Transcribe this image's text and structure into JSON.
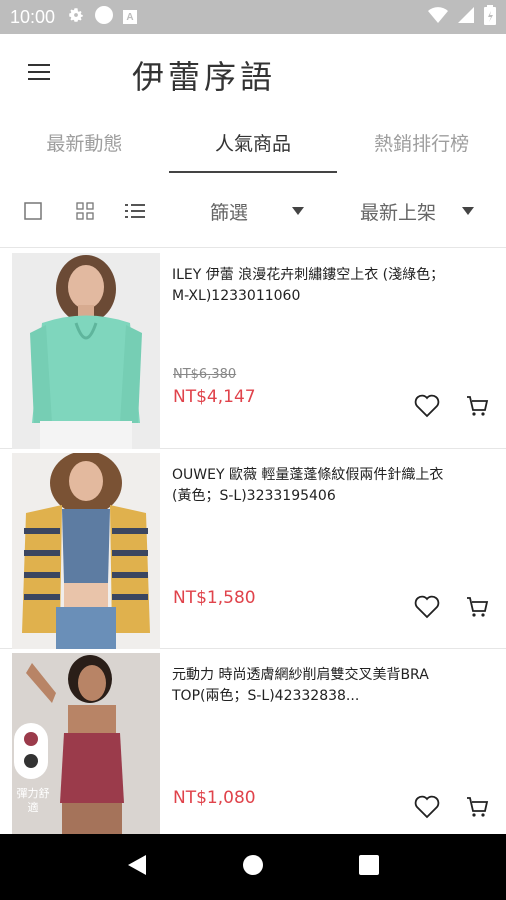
{
  "status_bar": {
    "time": "10:00",
    "mini_letter": "A"
  },
  "app": {
    "title": "伊蕾序語"
  },
  "tabs": [
    {
      "label": "最新動態",
      "active": false
    },
    {
      "label": "人氣商品",
      "active": true
    },
    {
      "label": "熱銷排行榜",
      "active": false
    }
  ],
  "toolbar": {
    "filter_label": "篩選",
    "sort_label": "最新上架"
  },
  "products": [
    {
      "name": "ILEY 伊蕾 浪漫花卉刺繡鏤空上衣 (淺綠色；M-XL)1233011060",
      "old_price": "NT$6,380",
      "price": "NT$4,147"
    },
    {
      "name": "OUWEY 歐薇 輕量蓬蓬條紋假兩件針織上衣 (黃色；S-L)3233195406",
      "old_price": "",
      "price": "NT$1,580"
    },
    {
      "name": "元動力 時尚透膚網紗削肩雙交叉美背BRA TOP(兩色；S-L)42332838...",
      "old_price": "",
      "price": "NT$1,080",
      "image_badge": "彈力舒適"
    }
  ],
  "colors": {
    "accent_price": "#e0434b",
    "status_bar": "#bdbdbd",
    "nav_bar": "#000000"
  }
}
